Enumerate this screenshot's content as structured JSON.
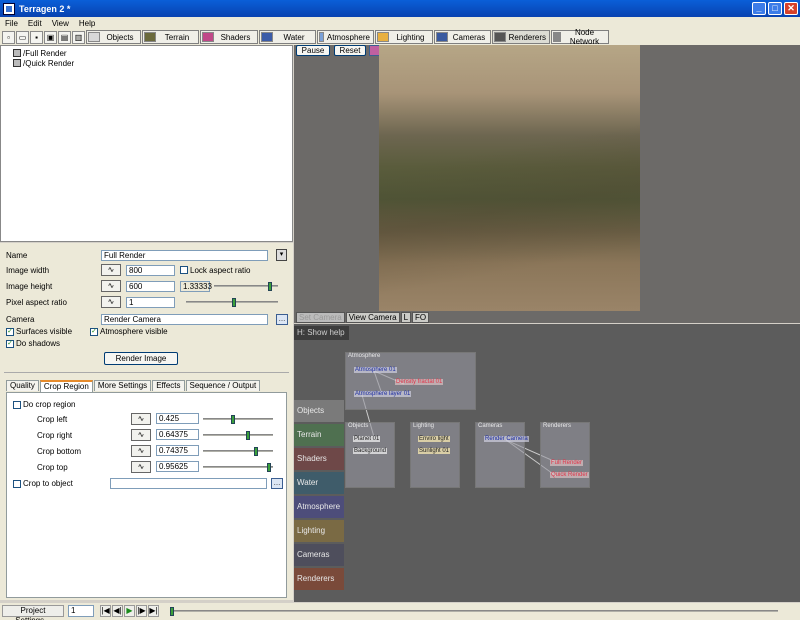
{
  "window": {
    "title": "Terragen 2 *",
    "controls": [
      "_",
      "□",
      "✕"
    ]
  },
  "menu": [
    "File",
    "Edit",
    "View",
    "Help"
  ],
  "toolbar": {
    "tabs": [
      "Objects",
      "Terrain",
      "Shaders",
      "Water",
      "Atmosphere",
      "Lighting",
      "Cameras",
      "Renderers",
      "Node Network"
    ]
  },
  "tree": {
    "items": [
      "/Full Render",
      "/Quick Render"
    ]
  },
  "props": {
    "name_label": "Name",
    "name_value": "Full Render",
    "width_label": "Image width",
    "width_value": "800",
    "lock_label": "Lock aspect ratio",
    "height_label": "Image height",
    "height_value": "600",
    "aspect_value": "1.33333",
    "pixel_label": "Pixel aspect ratio",
    "pixel_value": "1",
    "camera_label": "Camera",
    "camera_value": "Render Camera",
    "surfaces_label": "Surfaces visible",
    "atmosphere_label": "Atmosphere visible",
    "shadows_label": "Do shadows",
    "render_button": "Render Image",
    "subtabs": [
      "Quality",
      "Crop Region",
      "More Settings",
      "Effects",
      "Sequence / Output"
    ],
    "crop": {
      "do_crop_label": "Do crop region",
      "left_label": "Crop left",
      "left_value": "0.425",
      "right_label": "Crop right",
      "right_value": "0.64375",
      "bottom_label": "Crop bottom",
      "bottom_value": "0.74375",
      "top_label": "Crop top",
      "top_value": "0.95625",
      "object_label": "Crop to object",
      "object_value": ""
    }
  },
  "render": {
    "pause": "Pause",
    "reset": "Reset",
    "camera_buttons": [
      "Set Camera",
      "View Camera",
      "L",
      "FO"
    ]
  },
  "nodes": {
    "help": "H: Show help",
    "tabs": [
      "Objects",
      "Terrain",
      "Shaders",
      "Water",
      "Atmosphere",
      "Lighting",
      "Cameras",
      "Renderers"
    ],
    "tab_colors": [
      "#7a7a7a",
      "#4f7050",
      "#6e4848",
      "#3f5c6a",
      "#4d4d7a",
      "#7a6a44",
      "#4e4e5c",
      "#7a4a3a"
    ],
    "boxes": {
      "atmosphere": "Atmosphere",
      "objects": "Objects",
      "lighting": "Lighting",
      "cameras": "Cameras",
      "renderers": "Renderers"
    },
    "items": {
      "atmo1": "Atmosphere 01",
      "density": "Density fractal 01",
      "atmo_layer": "Atmosphere layer 01",
      "planet": "Planet 01",
      "background": "Background",
      "enviro": "Enviro light",
      "sunlight": "Sunlight 01",
      "render_camera": "Render Camera",
      "full_render": "Full Render",
      "quick_render": "Quick Render"
    }
  },
  "status": {
    "project_settings": "Project Settings...",
    "frame": "1",
    "playback": [
      "|◀",
      "◀|",
      "▶",
      "|▶",
      "▶|"
    ]
  }
}
